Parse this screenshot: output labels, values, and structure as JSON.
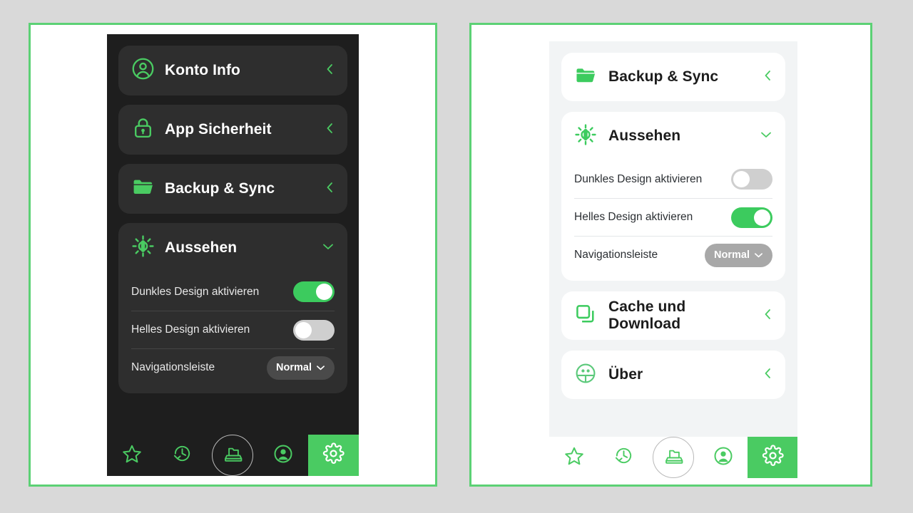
{
  "theme": {
    "accent": "#4acb62",
    "toggle_on": "#3ccb5e",
    "toggle_off": "#cfcfcf",
    "frame_border": "#5cd175",
    "dark_panel_bg": "#1e1e1e",
    "dark_card_bg": "#2e2e2e",
    "light_panel_bg": "#f2f4f5",
    "light_card_bg": "#ffffff",
    "page_bg": "#d9d9d9"
  },
  "dark_phone": {
    "rows": [
      {
        "label": "Konto Info",
        "icon": "account-circle-icon",
        "chevron": "left"
      },
      {
        "label": "App Sicherheit",
        "icon": "lock-icon",
        "chevron": "left"
      },
      {
        "label": "Backup & Sync",
        "icon": "folder-icon",
        "chevron": "left"
      }
    ],
    "appearance": {
      "label": "Aussehen",
      "icon": "brightness-icon",
      "chevron": "down",
      "settings": [
        {
          "label": "Dunkles Design aktivieren",
          "type": "toggle",
          "value": true
        },
        {
          "label": "Helles Design aktivieren",
          "type": "toggle",
          "value": false
        },
        {
          "label": "Navigationsleiste",
          "type": "select",
          "value": "Normal"
        }
      ]
    },
    "nav": [
      {
        "icon": "star-icon",
        "active": false,
        "ring": false
      },
      {
        "icon": "history-icon",
        "active": false,
        "ring": false
      },
      {
        "icon": "archive-box-icon",
        "active": false,
        "ring": true
      },
      {
        "icon": "person-icon",
        "active": false,
        "ring": false
      },
      {
        "icon": "gear-icon",
        "active": true,
        "ring": false
      }
    ]
  },
  "light_phone": {
    "backup": {
      "label": "Backup & Sync",
      "icon": "folder-icon",
      "chevron": "left"
    },
    "appearance": {
      "label": "Aussehen",
      "icon": "brightness-icon",
      "chevron": "down",
      "settings": [
        {
          "label": "Dunkles Design aktivieren",
          "type": "toggle",
          "value": false
        },
        {
          "label": "Helles Design aktivieren",
          "type": "toggle",
          "value": true
        },
        {
          "label": "Navigationsleiste",
          "type": "select",
          "value": "Normal"
        }
      ]
    },
    "cache": {
      "label": "Cache und Download",
      "icon": "layers-icon",
      "chevron": "left"
    },
    "about": {
      "label": "Über",
      "icon": "info-face-icon",
      "chevron": "left"
    },
    "nav": [
      {
        "icon": "star-icon",
        "active": false,
        "ring": false
      },
      {
        "icon": "history-icon",
        "active": false,
        "ring": false
      },
      {
        "icon": "archive-box-icon",
        "active": false,
        "ring": true
      },
      {
        "icon": "person-icon",
        "active": false,
        "ring": false
      },
      {
        "icon": "gear-icon",
        "active": true,
        "ring": false
      }
    ]
  }
}
